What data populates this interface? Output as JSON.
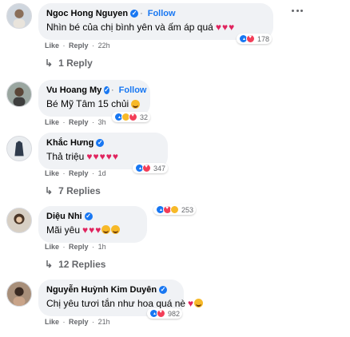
{
  "comments": [
    {
      "name": "Ngoc Hong Nguyen",
      "verified": true,
      "follow_label": "Follow",
      "text": "Nhìn bé của chị bình yên và ấm áp quá",
      "emojis": "❤️❤️❤️",
      "like_label": "Like",
      "reply_label": "Reply",
      "time": "22h",
      "reaction_count": "178",
      "replies_label": "1 Reply"
    },
    {
      "name": "Vu Hoang My",
      "verified": true,
      "follow_label": "Follow",
      "text": "Bé Mỹ Tâm 15 chủi",
      "emojis": "😂",
      "like_label": "Like",
      "reply_label": "Reply",
      "time": "3h",
      "reaction_count": "32"
    },
    {
      "name": "Khắc Hưng",
      "verified": true,
      "text": "Thả triệu",
      "emojis": "❤️❤️❤️❤️❤️",
      "like_label": "Like",
      "reply_label": "Reply",
      "time": "1d",
      "reaction_count": "347",
      "replies_label": "7 Replies"
    },
    {
      "name": "Diệu Nhi",
      "verified": true,
      "text": "Mãi yêu",
      "emojis": "❤️❤️❤️😍😍",
      "like_label": "Like",
      "reply_label": "Reply",
      "time": "1h",
      "reaction_count": "253",
      "replies_label": "12 Replies"
    },
    {
      "name": "Nguyễn Huỳnh Kim Duyên",
      "verified": true,
      "text": "Chị yêu tươi tắn như hoa quá nè",
      "emojis": "❤️😍",
      "like_label": "Like",
      "reply_label": "Reply",
      "time": "21h",
      "reaction_count": "982"
    }
  ],
  "left_margin_icons": [
    "person-with-flower-icon",
    "lipstick-icon",
    "dress-icon",
    "hat-icon"
  ],
  "colors": {
    "link_blue": "#1877f2",
    "bubble_bg": "#f0f2f5",
    "meta_gray": "#65676b",
    "heart_red": "#e0245e"
  }
}
